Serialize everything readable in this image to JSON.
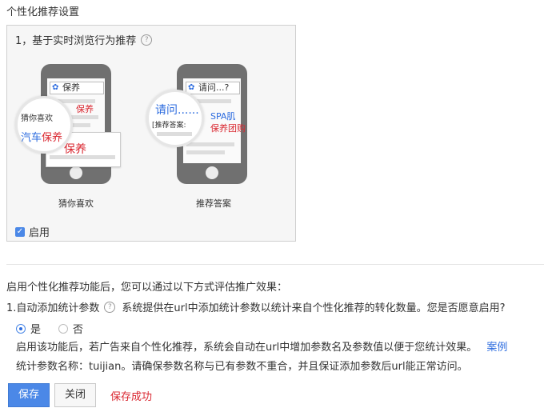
{
  "title": "个性化推荐设置",
  "section1": {
    "heading": "1，基于实时浏览行为推荐",
    "phone_left": {
      "search_text": "保养",
      "lens_title": "猜你喜欢",
      "lens_text_blue": "汽车",
      "lens_text_red": "保养",
      "peek_text": "保养",
      "popup_text": "保养",
      "caption": "猜你喜欢"
    },
    "phone_right": {
      "search_text": "请问...?",
      "lens_text": "请问......",
      "lens_label": "[推荐答案:",
      "peek_line1": "SPA肌",
      "peek_line2": "保养团购",
      "caption": "推荐答案"
    },
    "enable_label": "启用"
  },
  "section2": {
    "intro": "启用个性化推荐功能后，您可以通过以下方式评估推广效果：",
    "item_label": "1.自动添加统计参数",
    "item_desc": "系统提供在url中添加统计参数以统计来自个性化推荐的转化数量。您是否愿意启用?",
    "radio_yes": "是",
    "radio_no": "否",
    "note_line1": "启用该功能后，若广告来自个性化推荐，系统会自动在url中增加参数名及参数值以便于您统计效果。",
    "example_link": "案例",
    "note_line2": "统计参数名称：tuijian。请确保参数名称与已有参数不重合，并且保证添加参数后url能正常访问。"
  },
  "buttons": {
    "save": "保存",
    "close": "关闭"
  },
  "status": "保存成功",
  "colors": {
    "accent": "#4b88e7",
    "link": "#2d6cdf",
    "highlight_red": "#d9262f"
  }
}
